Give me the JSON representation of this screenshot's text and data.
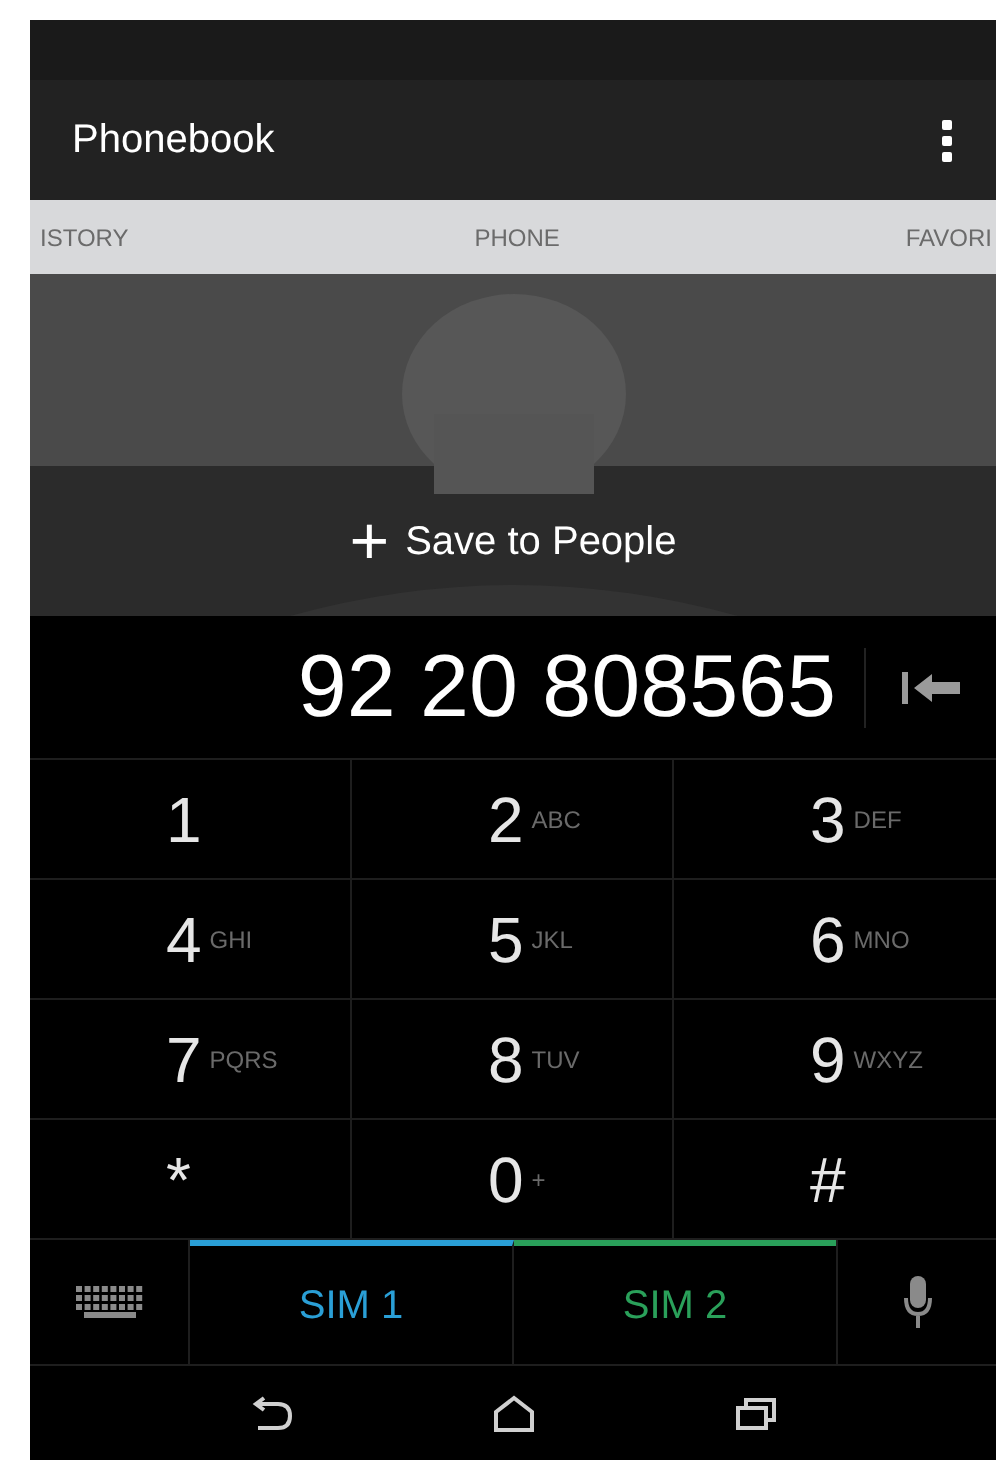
{
  "app_bar": {
    "title": "Phonebook"
  },
  "tabs": [
    {
      "label": "ISTORY"
    },
    {
      "label": "PHONE"
    },
    {
      "label": "FAVORI"
    }
  ],
  "save_action": {
    "icon": "+",
    "label": "Save to People"
  },
  "number": "92 20 808565",
  "keys": [
    {
      "digit": "1"
    },
    {
      "digit": "2",
      "letters": "ABC"
    },
    {
      "digit": "3",
      "letters": "DEF"
    },
    {
      "digit": "4",
      "letters": "GHI"
    },
    {
      "digit": "5",
      "letters": "JKL"
    },
    {
      "digit": "6",
      "letters": "MNO"
    },
    {
      "digit": "7",
      "letters": "PQRS"
    },
    {
      "digit": "8",
      "letters": "TUV"
    },
    {
      "digit": "9",
      "letters": "WXYZ"
    },
    {
      "digit": "*"
    },
    {
      "digit": "0",
      "letters": "+"
    },
    {
      "digit": "#"
    }
  ],
  "sims": [
    {
      "label": "SIM 1",
      "color": "#2a9fd6"
    },
    {
      "label": "SIM 2",
      "color": "#2aa05a"
    }
  ]
}
